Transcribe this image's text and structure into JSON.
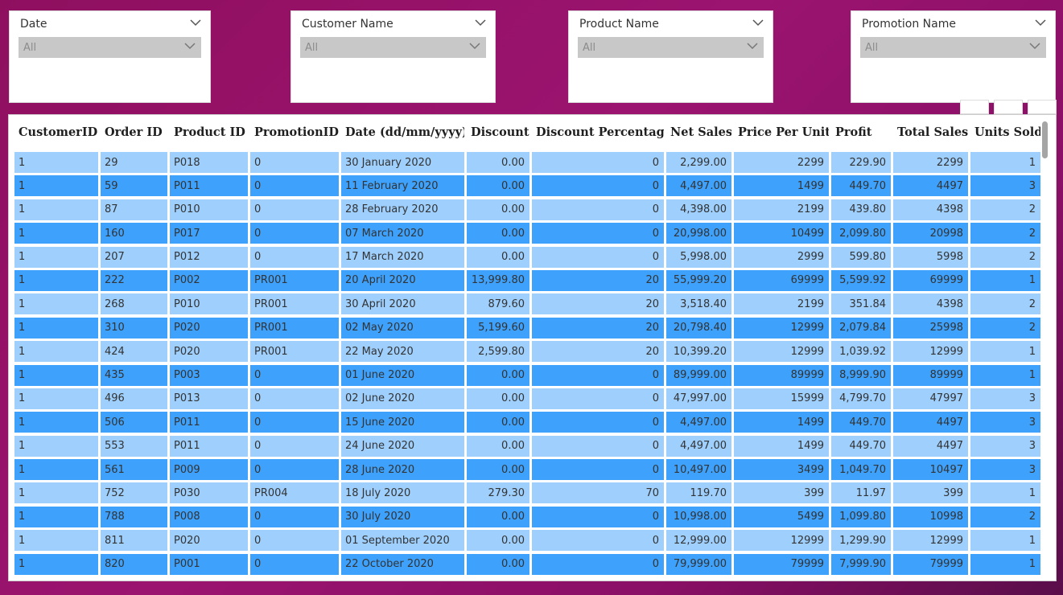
{
  "slicers": [
    {
      "title": "Date",
      "value": "All"
    },
    {
      "title": "Customer Name",
      "value": "All"
    },
    {
      "title": "Product Name",
      "value": "All"
    },
    {
      "title": "Promotion Name",
      "value": "All"
    }
  ],
  "table": {
    "columns": [
      "CustomerID",
      "Order ID",
      "Product ID",
      "PromotionID",
      "Date (dd/mm/yyyy)",
      "Discount",
      "Discount Percentage",
      "Net Sales",
      "Price Per Unit",
      "Profit",
      "Total Sales",
      "Units Sold"
    ],
    "rows": [
      [
        "1",
        "29",
        "P018",
        "0",
        "30 January 2020",
        "0.00",
        "0",
        "2,299.00",
        "2299",
        "229.90",
        "2299",
        "1"
      ],
      [
        "1",
        "59",
        "P011",
        "0",
        "11 February 2020",
        "0.00",
        "0",
        "4,497.00",
        "1499",
        "449.70",
        "4497",
        "3"
      ],
      [
        "1",
        "87",
        "P010",
        "0",
        "28 February 2020",
        "0.00",
        "0",
        "4,398.00",
        "2199",
        "439.80",
        "4398",
        "2"
      ],
      [
        "1",
        "160",
        "P017",
        "0",
        "07 March 2020",
        "0.00",
        "0",
        "20,998.00",
        "10499",
        "2,099.80",
        "20998",
        "2"
      ],
      [
        "1",
        "207",
        "P012",
        "0",
        "17 March 2020",
        "0.00",
        "0",
        "5,998.00",
        "2999",
        "599.80",
        "5998",
        "2"
      ],
      [
        "1",
        "222",
        "P002",
        "PR001",
        "20 April 2020",
        "13,999.80",
        "20",
        "55,999.20",
        "69999",
        "5,599.92",
        "69999",
        "1"
      ],
      [
        "1",
        "268",
        "P010",
        "PR001",
        "30 April 2020",
        "879.60",
        "20",
        "3,518.40",
        "2199",
        "351.84",
        "4398",
        "2"
      ],
      [
        "1",
        "310",
        "P020",
        "PR001",
        "02 May 2020",
        "5,199.60",
        "20",
        "20,798.40",
        "12999",
        "2,079.84",
        "25998",
        "2"
      ],
      [
        "1",
        "424",
        "P020",
        "PR001",
        "22 May 2020",
        "2,599.80",
        "20",
        "10,399.20",
        "12999",
        "1,039.92",
        "12999",
        "1"
      ],
      [
        "1",
        "435",
        "P003",
        "0",
        "01 June 2020",
        "0.00",
        "0",
        "89,999.00",
        "89999",
        "8,999.90",
        "89999",
        "1"
      ],
      [
        "1",
        "496",
        "P013",
        "0",
        "02 June 2020",
        "0.00",
        "0",
        "47,997.00",
        "15999",
        "4,799.70",
        "47997",
        "3"
      ],
      [
        "1",
        "506",
        "P011",
        "0",
        "15 June 2020",
        "0.00",
        "0",
        "4,497.00",
        "1499",
        "449.70",
        "4497",
        "3"
      ],
      [
        "1",
        "553",
        "P011",
        "0",
        "24 June 2020",
        "0.00",
        "0",
        "4,497.00",
        "1499",
        "449.70",
        "4497",
        "3"
      ],
      [
        "1",
        "561",
        "P009",
        "0",
        "28 June 2020",
        "0.00",
        "0",
        "10,497.00",
        "3499",
        "1,049.70",
        "10497",
        "3"
      ],
      [
        "1",
        "752",
        "P030",
        "PR004",
        "18 July 2020",
        "279.30",
        "70",
        "119.70",
        "399",
        "11.97",
        "399",
        "1"
      ],
      [
        "1",
        "788",
        "P008",
        "0",
        "30 July 2020",
        "0.00",
        "0",
        "10,998.00",
        "5499",
        "1,099.80",
        "10998",
        "2"
      ],
      [
        "1",
        "811",
        "P020",
        "0",
        "01 September 2020",
        "0.00",
        "0",
        "12,999.00",
        "12999",
        "1,299.90",
        "12999",
        "1"
      ],
      [
        "1",
        "820",
        "P001",
        "0",
        "22 October 2020",
        "0.00",
        "0",
        "79,999.00",
        "79999",
        "7,999.90",
        "79999",
        "1"
      ]
    ],
    "align": [
      "l",
      "l",
      "l",
      "l",
      "l",
      "r",
      "r",
      "r",
      "r",
      "r",
      "r",
      "r"
    ]
  },
  "colors": {
    "row_light": "#9ecffd",
    "row_dark": "#3ea1fb",
    "background": "#9b1470"
  },
  "icons": {
    "slicer_expand": "chevron-down-icon",
    "dropdown": "chevron-down-icon",
    "visual_header": [
      "filter-icon",
      "focus-mode-icon",
      "more-options-icon"
    ]
  }
}
